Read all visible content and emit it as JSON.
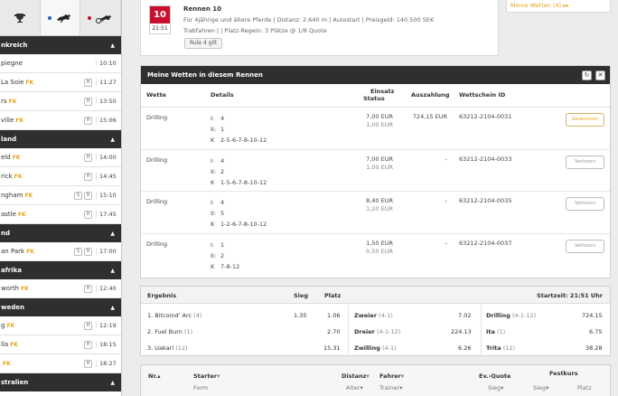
{
  "sidebar": {
    "tabs": [
      {
        "icon": "trophy-icon",
        "active": false
      },
      {
        "icon": "gallop-horse-icon",
        "active": true
      },
      {
        "icon": "trot-horse-icon",
        "active": false
      }
    ],
    "regions": [
      {
        "name": "nkreich",
        "rows": [
          {
            "name": "piegne",
            "fk": "",
            "badges": [],
            "time": "10:10"
          },
          {
            "name": "La Soie",
            "fk": "FK",
            "badges": [
              "H"
            ],
            "time": "11:27"
          },
          {
            "name": "rs",
            "fk": "FK",
            "badges": [
              "H"
            ],
            "time": "13:50"
          },
          {
            "name": "ville",
            "fk": "FK",
            "badges": [
              "H"
            ],
            "time": "15:06"
          }
        ]
      },
      {
        "name": "land",
        "rows": [
          {
            "name": "eld",
            "fk": "FK",
            "badges": [
              "H"
            ],
            "time": "14:00"
          },
          {
            "name": "rick",
            "fk": "FK",
            "badges": [
              "H"
            ],
            "time": "14:45"
          },
          {
            "name": "ngham",
            "fk": "FK",
            "badges": [
              "S",
              "H"
            ],
            "time": "15:10"
          },
          {
            "name": "astle",
            "fk": "FK",
            "badges": [
              "H"
            ],
            "time": "17:45"
          }
        ]
      },
      {
        "name": "nd",
        "rows": [
          {
            "name": "an Park",
            "fk": "FK",
            "badges": [
              "S",
              "H"
            ],
            "time": "17:00"
          }
        ]
      },
      {
        "name": "afrika",
        "rows": [
          {
            "name": "worth",
            "fk": "FK",
            "badges": [
              "H"
            ],
            "time": "12:40"
          }
        ]
      },
      {
        "name": "weden",
        "rows": [
          {
            "name": "g",
            "fk": "FK",
            "badges": [
              "H"
            ],
            "time": "12:19"
          },
          {
            "name": "lla",
            "fk": "FK",
            "badges": [
              "H"
            ],
            "time": "18:15"
          },
          {
            "name": "",
            "fk": "FK",
            "badges": [
              "H"
            ],
            "time": "18:27"
          }
        ]
      },
      {
        "name": "stralien",
        "rows": []
      }
    ]
  },
  "race": {
    "number": "10",
    "time": "21:51",
    "title": "Rennen 10",
    "line1": "Für 4jährige und ältere Pferde  |  Distanz: 2.640 m  |  Autostart  |  Preisgeld: 140.500 SEK",
    "line2": "Trabfahren  |  |  Platz-Regein: 3 Plätze @ 1/8 Quote",
    "rule_button": "Rule 4 gilt",
    "my_bets_link": "Meine Wetten (4)",
    "my_bets_arrow": "▸▸"
  },
  "bets": {
    "title": "Meine Wetten in diesem Rennen",
    "headers": {
      "bet": "Wette",
      "details": "Details",
      "stake_1": "Einsatz",
      "stake_2": "Status",
      "payout": "Auszahlung",
      "ticket": "Wettschein ID"
    },
    "rows": [
      {
        "type": "Drilling",
        "lines": [
          {
            "l": "I:",
            "v": "4"
          },
          {
            "l": "II:",
            "v": "1"
          },
          {
            "l": "K",
            "v": "2-5-6-7-8-10-12"
          }
        ],
        "stake": "7,00 EUR",
        "stake_sub": "1,00 EUR",
        "payout": "724,15 EUR",
        "ticket": "63212-2104-0031",
        "status": "Gewonnen",
        "won": true
      },
      {
        "type": "Drilling",
        "lines": [
          {
            "l": "I:",
            "v": "4"
          },
          {
            "l": "II:",
            "v": "2"
          },
          {
            "l": "K",
            "v": "1-5-6-7-8-10-12"
          }
        ],
        "stake": "7,00 EUR",
        "stake_sub": "1,00 EUR",
        "payout": "-",
        "ticket": "63212-2104-0033",
        "status": "Verloren",
        "won": false
      },
      {
        "type": "Drilling",
        "lines": [
          {
            "l": "I:",
            "v": "4"
          },
          {
            "l": "II:",
            "v": "5"
          },
          {
            "l": "K",
            "v": "1-2-6-7-8-10-12"
          }
        ],
        "stake": "8,40 EUR",
        "stake_sub": "1,20 EUR",
        "payout": "-",
        "ticket": "63212-2104-0035",
        "status": "Verloren",
        "won": false
      },
      {
        "type": "Drilling",
        "lines": [
          {
            "l": "I:",
            "v": "1"
          },
          {
            "l": "II:",
            "v": "2"
          },
          {
            "l": "K",
            "v": "7-8-12"
          }
        ],
        "stake": "1,50 EUR",
        "stake_sub": "0,50 EUR",
        "payout": "-",
        "ticket": "63212-2104-0037",
        "status": "Verloren",
        "won": false
      }
    ]
  },
  "results": {
    "headers": {
      "result": "Ergebnis",
      "win": "Sieg",
      "place": "Platz",
      "start_time": "Startzeit: 21:51 Uhr"
    },
    "finish": [
      {
        "pos": "1. Bitcoind' Arc",
        "num": "(4)",
        "win": "1.35",
        "place": "1.06"
      },
      {
        "pos": "2. Fuel Burn",
        "num": "(1)",
        "win": "",
        "place": "2.70"
      },
      {
        "pos": "3. Uakari",
        "num": "(12)",
        "win": "",
        "place": "15.31"
      }
    ],
    "exotics_mid": [
      {
        "name": "Zweier",
        "combo": "(4-1)",
        "value": "7.02"
      },
      {
        "name": "Dreier",
        "combo": "(4-1-12)",
        "value": "224.13"
      },
      {
        "name": "Zwilling",
        "combo": "(4-1)",
        "value": "6.26"
      }
    ],
    "exotics_right": [
      {
        "name": "Drilling",
        "combo": "(4-1-12)",
        "value": "724.15"
      },
      {
        "name": "Ita",
        "combo": "(1)",
        "value": "6.75"
      },
      {
        "name": "Trita",
        "combo": "(12)",
        "value": "38.28"
      }
    ]
  },
  "starters": {
    "nr": "Nr.▴",
    "starter": "Starter",
    "form": "Form",
    "distance": "Distanz",
    "age": "Alter",
    "driver": "Fahrer",
    "trainer": "Trainer",
    "ev_quote": "Ev.-Quote",
    "win": "Sieg",
    "fixed": "Festkurs",
    "fixed_win": "Sieg",
    "fixed_place": "Platz",
    "sort_caret": "▾"
  },
  "colors": {
    "accent": "#e8a31a",
    "race_red": "#c8102e",
    "dark_bar": "#2f2f2f"
  }
}
